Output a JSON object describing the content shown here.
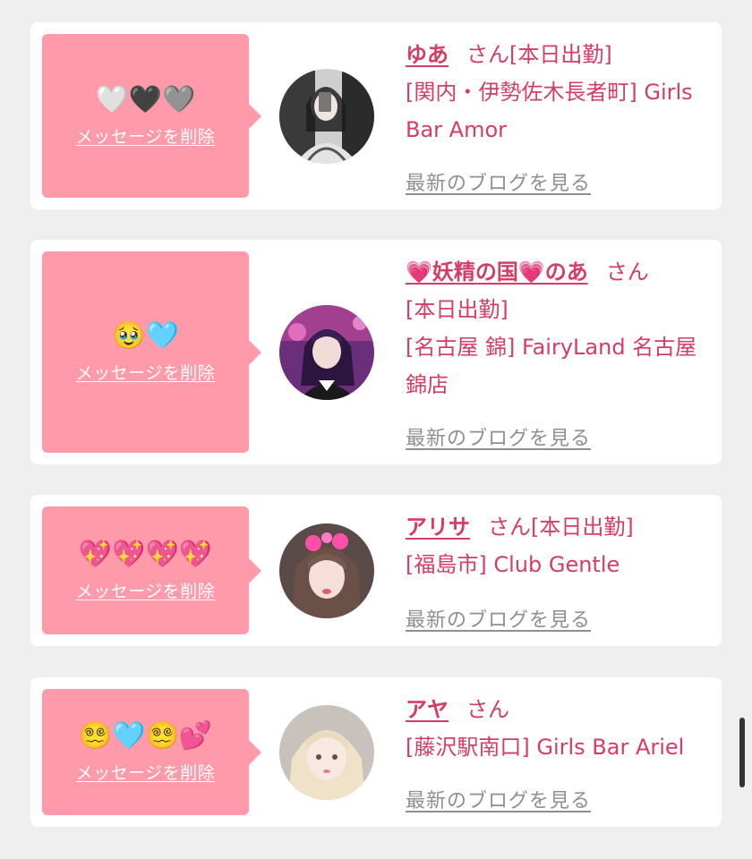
{
  "colors": {
    "background": "#efefef",
    "card": "#ffffff",
    "bubble": "#ff9aab",
    "accent": "#d43d65",
    "link_gray": "#8f8f8f"
  },
  "delete_label": "メッセージを削除",
  "blog_label": "最新のブログを見る",
  "honorific": "さん",
  "entries": [
    {
      "message": "🤍🖤🩶",
      "name": "ゆあ",
      "status": "[本日出勤]",
      "shop": "[関内・伊勢佐木長者町] Girls Bar Amor",
      "avatar_icon": "avatar-photo"
    },
    {
      "message": "🥹🩵",
      "name": "💗妖精の国💗のあ",
      "status": "[本日出勤]",
      "shop": "[名古屋 錦] FairyLand 名古屋錦店",
      "avatar_icon": "avatar-photo"
    },
    {
      "message": "💖💖💖💖",
      "name": "アリサ",
      "status": "[本日出勤]",
      "shop": "[福島市] Club Gentle",
      "avatar_icon": "avatar-photo"
    },
    {
      "message": "😵‍💫🩵😵‍💫💕",
      "name": "アヤ",
      "status": "",
      "shop": "[藤沢駅南口] Girls Bar Ariel",
      "avatar_icon": "avatar-photo"
    }
  ]
}
